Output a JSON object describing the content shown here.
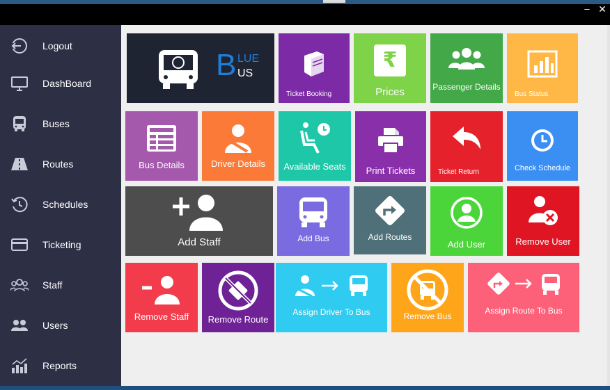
{
  "window": {
    "minimize_glyph": "–",
    "close_glyph": "✕"
  },
  "sidebar": {
    "items": [
      {
        "label": "Logout",
        "icon": "logout-icon"
      },
      {
        "label": "DashBoard",
        "icon": "monitor-icon"
      },
      {
        "label": "Buses",
        "icon": "bus-icon"
      },
      {
        "label": "Routes",
        "icon": "road-icon"
      },
      {
        "label": "Schedules",
        "icon": "history-icon"
      },
      {
        "label": "Ticketing",
        "icon": "card-icon"
      },
      {
        "label": "Staff",
        "icon": "group-icon"
      },
      {
        "label": "Users",
        "icon": "users-icon"
      },
      {
        "label": "Reports",
        "icon": "chart-icon"
      }
    ]
  },
  "logo": {
    "letter": "B",
    "line1": "LUE",
    "line2": "US"
  },
  "tiles": {
    "ticket_booking": "Ticket Booking",
    "prices": "Prices",
    "prices_glyph": "₹",
    "passenger_details": "Passenger Details",
    "bus_status": "Bus Status",
    "bus_details": "Bus Details",
    "driver_details": "Driver Details",
    "available_seats": "Available Seats",
    "print_tickets": "Print Tickets",
    "ticket_return": "Ticket Return",
    "check_schedule": "Check Schedule",
    "add_staff": "Add Staff",
    "add_bus": "Add Bus",
    "add_routes": "Add Routes",
    "add_user": "Add User",
    "remove_user": "Remove User",
    "remove_staff": "Remove Staff",
    "remove_route": "Remove Route",
    "assign_driver_to_bus": "Assign Driver To Bus",
    "remove_bus": "Remove Bus",
    "assign_route_to_bus": "Assign Route To Bus"
  },
  "colors": {
    "sidebar": "#2d2f45",
    "logo_tile": "#1f2433",
    "ticket_booking": "#7d2aa6",
    "prices": "#7ed348",
    "passenger_details": "#43a847",
    "bus_status": "#ffb845",
    "bus_details": "#a559ad",
    "driver_details": "#fc7a37",
    "available_seats": "#1ec7a8",
    "print_tickets": "#8a2faa",
    "ticket_return": "#e5212b",
    "check_schedule": "#3b8ef2",
    "add_staff": "#4d4d4d",
    "add_bus": "#7b6be0",
    "add_routes": "#4f7078",
    "add_user": "#4cd53b",
    "remove_user": "#df1523",
    "remove_staff": "#f23c4c",
    "remove_route": "#6e2295",
    "assign_driver_to_bus": "#30cbf0",
    "remove_bus": "#ffa51a",
    "assign_route_to_bus": "#fc6179"
  }
}
